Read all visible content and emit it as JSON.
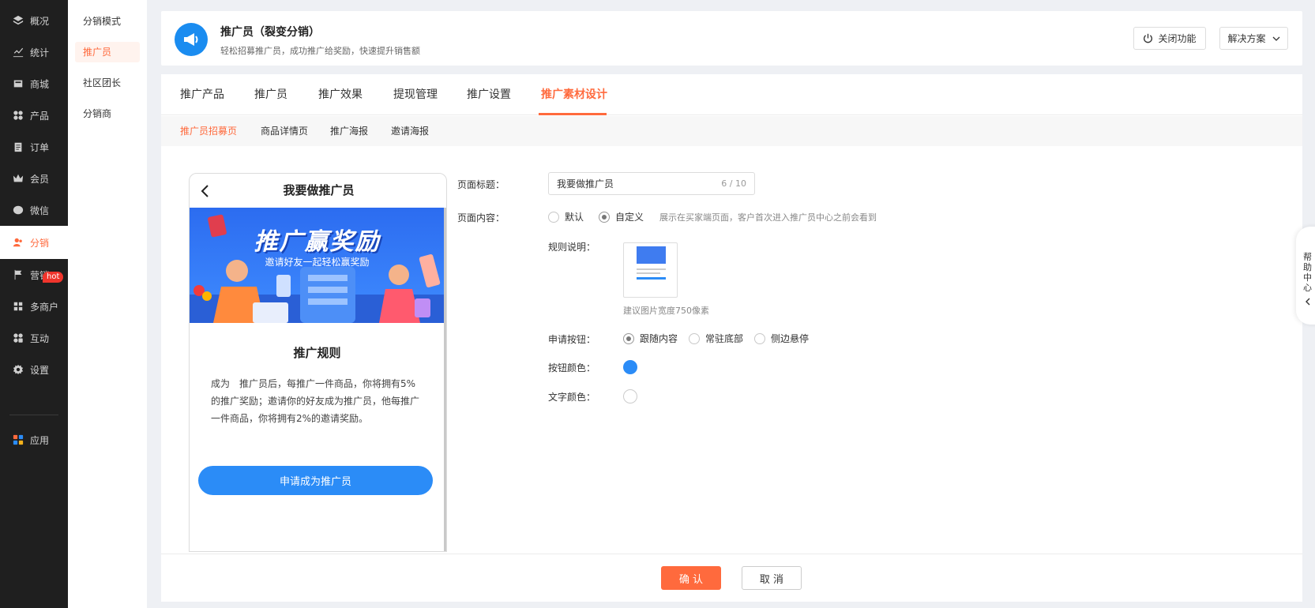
{
  "nav": [
    {
      "label": "概况",
      "icon": "layers-icon"
    },
    {
      "label": "统计",
      "icon": "chart-icon"
    },
    {
      "label": "商城",
      "icon": "store-icon"
    },
    {
      "label": "产品",
      "icon": "grid-icon"
    },
    {
      "label": "订单",
      "icon": "clipboard-icon"
    },
    {
      "label": "会员",
      "icon": "crown-icon"
    },
    {
      "label": "微信",
      "icon": "wechat-icon"
    },
    {
      "label": "分销",
      "icon": "users-icon"
    },
    {
      "label": "营销",
      "icon": "flag-icon"
    },
    {
      "label": "多商户",
      "icon": "shop-icon"
    },
    {
      "label": "互动",
      "icon": "apps-icon"
    },
    {
      "label": "设置",
      "icon": "gear-icon"
    },
    {
      "label": "应用",
      "icon": "app-grid-icon"
    }
  ],
  "nav_hot": "hot",
  "subnav": [
    "分销模式",
    "推广员",
    "社区团长",
    "分销商"
  ],
  "header": {
    "title": "推广员（裂变分销）",
    "desc": "轻松招募推广员，成功推广给奖励，快速提升销售额",
    "close_btn": "关闭功能",
    "solution_btn": "解决方案"
  },
  "tabs": [
    "推广产品",
    "推广员",
    "推广效果",
    "提现管理",
    "推广设置",
    "推广素材设计"
  ],
  "subtabs": [
    "推广员招募页",
    "商品详情页",
    "推广海报",
    "邀请海报"
  ],
  "phone": {
    "title": "我要做推广员",
    "banner_title": "推广赢奖励",
    "banner_sub": "邀请好友一起轻松赢奖励",
    "rule_title": "推广规则",
    "rule_text": "成为　推广员后，每推广一件商品，你将拥有5%的推广奖励；邀请你的好友成为推广员，他每推广一件商品，你将拥有2%的邀请奖励。",
    "apply_btn": "申请成为推广员"
  },
  "form": {
    "page_title_label": "页面标题：",
    "page_title_value": "我要做推广员",
    "page_title_count": "6 / 10",
    "page_content_label": "页面内容：",
    "content_default": "默认",
    "content_custom": "自定义",
    "content_hint": "展示在买家端页面，客户首次进入推广员中心之前会看到",
    "rule_label": "规则说明：",
    "img_hint": "建议图片宽度750像素",
    "apply_btn_label": "申请按钮：",
    "btn_follow": "跟随内容",
    "btn_bottom": "常驻底部",
    "btn_side": "侧边悬停",
    "btn_color_label": "按钮颜色：",
    "btn_color": "#2b8cf7",
    "text_color_label": "文字颜色：",
    "text_color": "#ffffff"
  },
  "footer": {
    "ok": "确 认",
    "cancel": "取 消"
  },
  "help": "帮助中心",
  "colors": {
    "accent": "#ff6a3d",
    "primary": "#2b8cf7"
  }
}
